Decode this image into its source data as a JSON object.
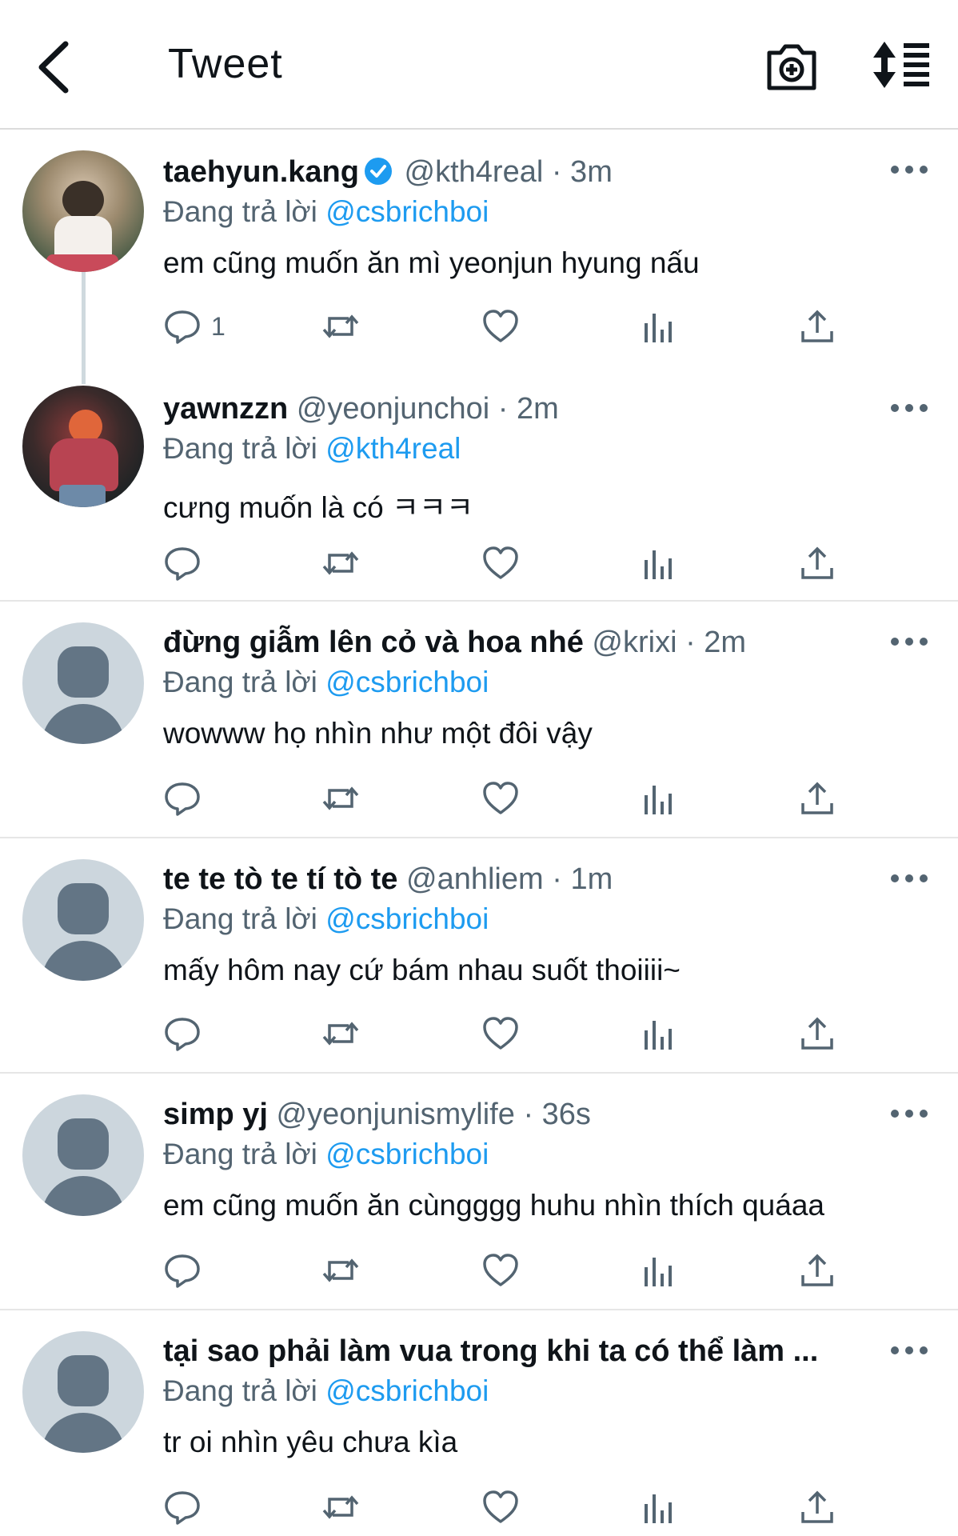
{
  "header": {
    "title": "Tweet",
    "icons": [
      "back-arrow-icon",
      "camera-plus-icon",
      "sort-icon"
    ]
  },
  "colors": {
    "accent": "#1d9bf0",
    "secondary_text": "#536471",
    "primary_text": "#0f1419",
    "divider": "#e6e6e6"
  },
  "tweets": [
    {
      "name": "taehyun.kang",
      "verified": true,
      "handle": "@kth4real",
      "time": "· 3m",
      "replying_prefix": "Đang trả lời",
      "replying_to": "@csbrichboi",
      "text": "em cũng muốn ăn mì yeonjun hyung nấu",
      "reply_count": "1",
      "avatar": "photo"
    },
    {
      "name": "yawnzzn",
      "verified": false,
      "handle": "@yeonjunchoi",
      "time": "· 2m",
      "replying_prefix": "Đang trả lời",
      "replying_to": "@kth4real",
      "text": "cưng muốn là có ㅋㅋㅋ",
      "reply_count": "",
      "avatar": "photo"
    },
    {
      "name": "đừng giẫm lên cỏ và hoa nhé",
      "verified": false,
      "handle": "@krixi",
      "time": "· 2m",
      "replying_prefix": "Đang trả lời",
      "replying_to": "@csbrichboi",
      "text": "wowww họ nhìn như một đôi vậy",
      "reply_count": "",
      "avatar": "default"
    },
    {
      "name": "te te tò te tí tò te",
      "verified": false,
      "handle": "@anhliem",
      "time": "· 1m",
      "replying_prefix": "Đang trả lời",
      "replying_to": "@csbrichboi",
      "text": "mấy hôm nay cứ bám nhau suốt thoiiii~",
      "reply_count": "",
      "avatar": "default"
    },
    {
      "name": "simp yj",
      "verified": false,
      "handle": "@yeonjunismylife",
      "time": "· 36s",
      "replying_prefix": "Đang trả lời",
      "replying_to": "@csbrichboi",
      "text": "em cũng muốn ăn cùngggg huhu nhìn thích quáaa",
      "reply_count": "",
      "avatar": "default"
    },
    {
      "name": "tại sao phải làm vua trong khi ta có thể làm ...",
      "verified": false,
      "handle": "",
      "time": "",
      "replying_prefix": "Đang trả lời",
      "replying_to": "@csbrichboi",
      "text": "tr oi nhìn yêu chưa kìa",
      "reply_count": "",
      "avatar": "default"
    }
  ],
  "action_icons": [
    "reply-icon",
    "retweet-icon",
    "like-icon",
    "analytics-icon",
    "share-icon"
  ]
}
